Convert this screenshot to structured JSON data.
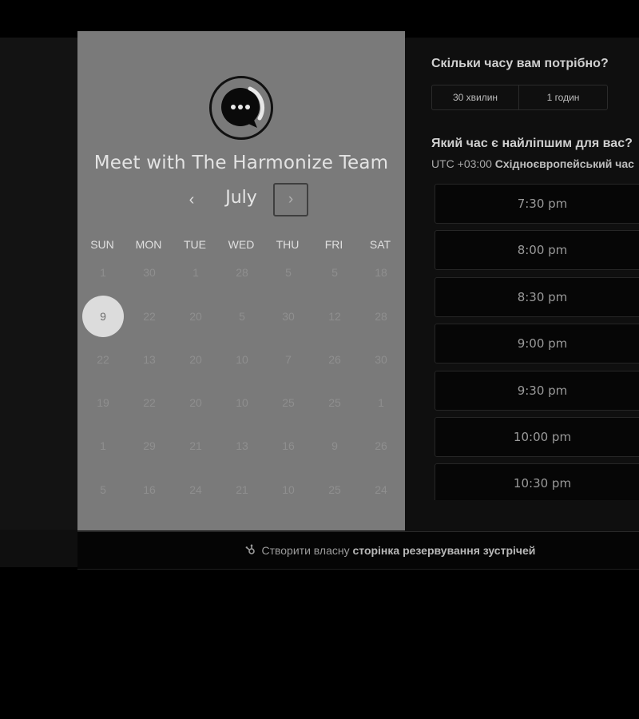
{
  "widget": {
    "title": "Meet with The Harmonize Team",
    "month": "July",
    "prev_icon": "chevron-left-icon",
    "next_icon": "chevron-right-icon",
    "prev_label": "‹",
    "next_label": "›"
  },
  "calendar": {
    "weekdays": [
      "SUN",
      "MON",
      "TUE",
      "WED",
      "THU",
      "FRI",
      "SAT"
    ],
    "weeks": [
      [
        "1",
        "30",
        "1",
        "28",
        "5",
        "5",
        "18"
      ],
      [
        "9",
        "22",
        "20",
        "5",
        "30",
        "12",
        "28"
      ],
      [
        "22",
        "13",
        "20",
        "10",
        "7",
        "26",
        "30"
      ],
      [
        "19",
        "22",
        "20",
        "10",
        "25",
        "25",
        "1"
      ],
      [
        "1",
        "29",
        "21",
        "13",
        "16",
        "9",
        "26"
      ],
      [
        "5",
        "16",
        "24",
        "21",
        "10",
        "25",
        "24"
      ]
    ],
    "selected": "9"
  },
  "duration": {
    "title": "Скільки часу вам потрібно?",
    "options": [
      "30 хвилин",
      "1 годин"
    ]
  },
  "time": {
    "title": "Який час є найліпшим для вас?",
    "tz_offset": "UTC +03:00",
    "tz_name": "Східноєвропейський час",
    "slots": [
      "7:30 pm",
      "8:00 pm",
      "8:30 pm",
      "9:00 pm",
      "9:30 pm",
      "10:00 pm",
      "10:30 pm"
    ]
  },
  "footer": {
    "icon": "hubspot-sprocket-icon",
    "prefix": "Створити власну",
    "link": "сторінка резервування зустрічей"
  }
}
